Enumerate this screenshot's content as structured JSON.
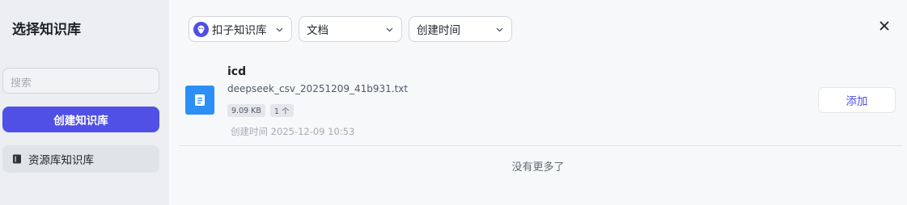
{
  "sidebar": {
    "title": "选择知识库",
    "search_placeholder": "搜索",
    "create_button": "创建知识库",
    "items": [
      {
        "label": "资源库知识库",
        "icon": "book-icon"
      }
    ]
  },
  "filters": {
    "bot": {
      "label": "扣子知识库",
      "icon": "bot-icon"
    },
    "type": {
      "label": "文档"
    },
    "sort": {
      "label": "创建时间"
    }
  },
  "result": {
    "name": "icd",
    "file_name": "deepseek_csv_20251209_41b931.txt",
    "size": "9.09 KB",
    "count": "1 个",
    "created": "创建时间 2025-12-09 10:53",
    "add_label": "添加"
  },
  "footer": {
    "no_more": "没有更多了"
  },
  "colors": {
    "accent": "#5050e6",
    "doc_icon": "#2b8ff5"
  }
}
